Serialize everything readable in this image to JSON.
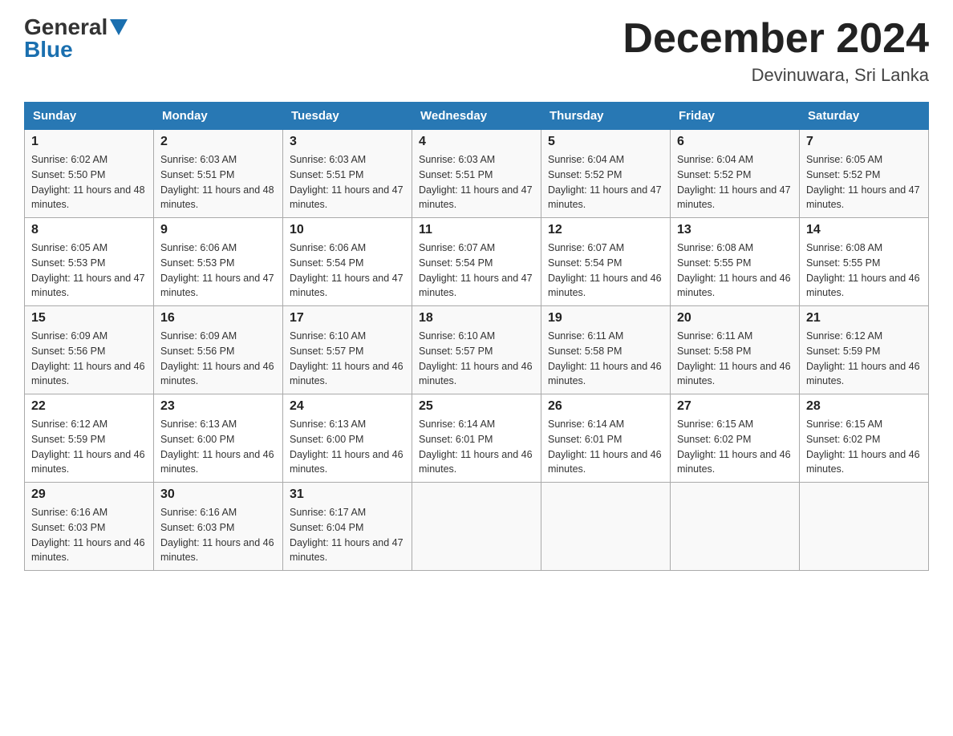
{
  "logo": {
    "text_general": "General",
    "text_blue": "Blue",
    "arrow_color": "#1a6faf"
  },
  "header": {
    "month_title": "December 2024",
    "location": "Devinuwara, Sri Lanka"
  },
  "weekdays": [
    "Sunday",
    "Monday",
    "Tuesday",
    "Wednesday",
    "Thursday",
    "Friday",
    "Saturday"
  ],
  "weeks": [
    [
      {
        "day": "1",
        "sunrise": "6:02 AM",
        "sunset": "5:50 PM",
        "daylight": "11 hours and 48 minutes."
      },
      {
        "day": "2",
        "sunrise": "6:03 AM",
        "sunset": "5:51 PM",
        "daylight": "11 hours and 48 minutes."
      },
      {
        "day": "3",
        "sunrise": "6:03 AM",
        "sunset": "5:51 PM",
        "daylight": "11 hours and 47 minutes."
      },
      {
        "day": "4",
        "sunrise": "6:03 AM",
        "sunset": "5:51 PM",
        "daylight": "11 hours and 47 minutes."
      },
      {
        "day": "5",
        "sunrise": "6:04 AM",
        "sunset": "5:52 PM",
        "daylight": "11 hours and 47 minutes."
      },
      {
        "day": "6",
        "sunrise": "6:04 AM",
        "sunset": "5:52 PM",
        "daylight": "11 hours and 47 minutes."
      },
      {
        "day": "7",
        "sunrise": "6:05 AM",
        "sunset": "5:52 PM",
        "daylight": "11 hours and 47 minutes."
      }
    ],
    [
      {
        "day": "8",
        "sunrise": "6:05 AM",
        "sunset": "5:53 PM",
        "daylight": "11 hours and 47 minutes."
      },
      {
        "day": "9",
        "sunrise": "6:06 AM",
        "sunset": "5:53 PM",
        "daylight": "11 hours and 47 minutes."
      },
      {
        "day": "10",
        "sunrise": "6:06 AM",
        "sunset": "5:54 PM",
        "daylight": "11 hours and 47 minutes."
      },
      {
        "day": "11",
        "sunrise": "6:07 AM",
        "sunset": "5:54 PM",
        "daylight": "11 hours and 47 minutes."
      },
      {
        "day": "12",
        "sunrise": "6:07 AM",
        "sunset": "5:54 PM",
        "daylight": "11 hours and 46 minutes."
      },
      {
        "day": "13",
        "sunrise": "6:08 AM",
        "sunset": "5:55 PM",
        "daylight": "11 hours and 46 minutes."
      },
      {
        "day": "14",
        "sunrise": "6:08 AM",
        "sunset": "5:55 PM",
        "daylight": "11 hours and 46 minutes."
      }
    ],
    [
      {
        "day": "15",
        "sunrise": "6:09 AM",
        "sunset": "5:56 PM",
        "daylight": "11 hours and 46 minutes."
      },
      {
        "day": "16",
        "sunrise": "6:09 AM",
        "sunset": "5:56 PM",
        "daylight": "11 hours and 46 minutes."
      },
      {
        "day": "17",
        "sunrise": "6:10 AM",
        "sunset": "5:57 PM",
        "daylight": "11 hours and 46 minutes."
      },
      {
        "day": "18",
        "sunrise": "6:10 AM",
        "sunset": "5:57 PM",
        "daylight": "11 hours and 46 minutes."
      },
      {
        "day": "19",
        "sunrise": "6:11 AM",
        "sunset": "5:58 PM",
        "daylight": "11 hours and 46 minutes."
      },
      {
        "day": "20",
        "sunrise": "6:11 AM",
        "sunset": "5:58 PM",
        "daylight": "11 hours and 46 minutes."
      },
      {
        "day": "21",
        "sunrise": "6:12 AM",
        "sunset": "5:59 PM",
        "daylight": "11 hours and 46 minutes."
      }
    ],
    [
      {
        "day": "22",
        "sunrise": "6:12 AM",
        "sunset": "5:59 PM",
        "daylight": "11 hours and 46 minutes."
      },
      {
        "day": "23",
        "sunrise": "6:13 AM",
        "sunset": "6:00 PM",
        "daylight": "11 hours and 46 minutes."
      },
      {
        "day": "24",
        "sunrise": "6:13 AM",
        "sunset": "6:00 PM",
        "daylight": "11 hours and 46 minutes."
      },
      {
        "day": "25",
        "sunrise": "6:14 AM",
        "sunset": "6:01 PM",
        "daylight": "11 hours and 46 minutes."
      },
      {
        "day": "26",
        "sunrise": "6:14 AM",
        "sunset": "6:01 PM",
        "daylight": "11 hours and 46 minutes."
      },
      {
        "day": "27",
        "sunrise": "6:15 AM",
        "sunset": "6:02 PM",
        "daylight": "11 hours and 46 minutes."
      },
      {
        "day": "28",
        "sunrise": "6:15 AM",
        "sunset": "6:02 PM",
        "daylight": "11 hours and 46 minutes."
      }
    ],
    [
      {
        "day": "29",
        "sunrise": "6:16 AM",
        "sunset": "6:03 PM",
        "daylight": "11 hours and 46 minutes."
      },
      {
        "day": "30",
        "sunrise": "6:16 AM",
        "sunset": "6:03 PM",
        "daylight": "11 hours and 46 minutes."
      },
      {
        "day": "31",
        "sunrise": "6:17 AM",
        "sunset": "6:04 PM",
        "daylight": "11 hours and 47 minutes."
      },
      null,
      null,
      null,
      null
    ]
  ]
}
